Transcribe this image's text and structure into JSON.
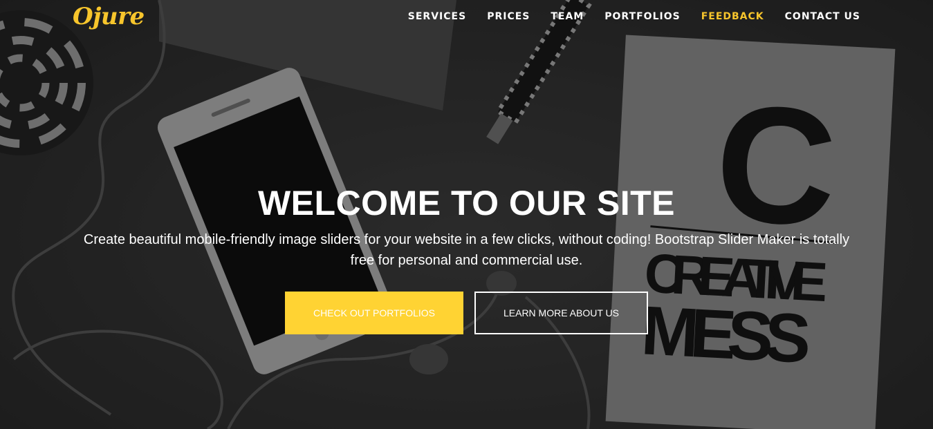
{
  "nav": {
    "logo": "Ojure",
    "items": [
      {
        "label": "SERVICES",
        "active": false
      },
      {
        "label": "PRICES",
        "active": false
      },
      {
        "label": "TEAM",
        "active": false
      },
      {
        "label": "PORTFOLIOS",
        "active": false
      },
      {
        "label": "FEEDBACK",
        "active": true
      },
      {
        "label": "CONTACT US",
        "active": false
      }
    ]
  },
  "hero": {
    "title": "WELCOME TO OUR SITE",
    "text": "Create beautiful mobile-friendly image sliders for your website in a few clicks, without coding! Bootstrap Slider Maker is totally free for personal and commercial use.",
    "primary_button": "CHECK OUT PORTFOLIOS",
    "secondary_button": "LEARN MORE ABOUT US"
  },
  "background": {
    "notebook_letter": "C",
    "notebook_line1": "CREATIVE",
    "notebook_line2": "MESS"
  },
  "colors": {
    "accent": "#f7c52c",
    "button": "#ffd333",
    "text": "#ffffff"
  }
}
